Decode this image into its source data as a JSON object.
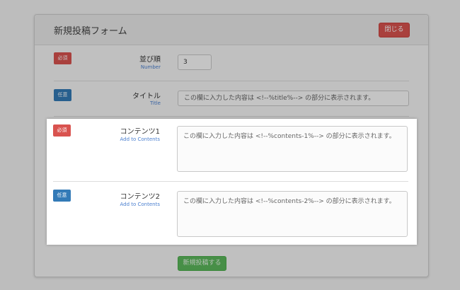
{
  "form": {
    "title": "新規投稿フォーム",
    "close_label": "閉じる",
    "submit_label": "新規投稿する",
    "fields": [
      {
        "badge": "必須",
        "badge_type": "required",
        "label": "並び順",
        "sublabel": "Number",
        "value": "3",
        "placeholder": ""
      },
      {
        "badge": "任意",
        "badge_type": "optional",
        "label": "タイトル",
        "sublabel": "Title",
        "value": "",
        "placeholder": "この欄に入力した内容は <!--%title%--> の部分に表示されます。"
      },
      {
        "badge": "必須",
        "badge_type": "required",
        "label": "コンテンツ1",
        "sublabel": "Add to Contents",
        "value": "",
        "placeholder": "この欄に入力した内容は <!--%contents-1%--> の部分に表示されます。"
      },
      {
        "badge": "任意",
        "badge_type": "optional",
        "label": "コンテンツ2",
        "sublabel": "Add to Contents",
        "value": "",
        "placeholder": "この欄に入力した内容は <!--%contents-2%--> の部分に表示されます。"
      }
    ]
  },
  "colors": {
    "required": "#d9534f",
    "optional": "#337ab7",
    "submit": "#5cb85c",
    "link": "#4a7fcf"
  }
}
